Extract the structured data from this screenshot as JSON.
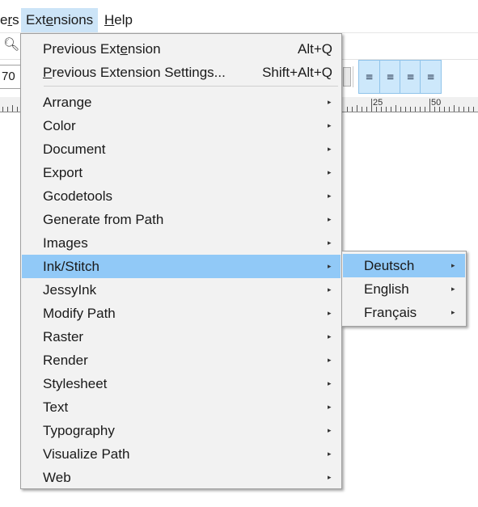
{
  "menubar": {
    "items": [
      {
        "label": "ers",
        "underline_index": 1
      },
      {
        "label": "Extensions",
        "underline_index": 3
      },
      {
        "label": "Help",
        "underline_index": 0
      }
    ]
  },
  "toolbar": {
    "zoom_icon": "zoom-icon",
    "width_value": "70",
    "align_icons": [
      "align-icon",
      "align-icon",
      "align-icon",
      "align-icon"
    ]
  },
  "ruler": {
    "labels": [
      "25",
      "50"
    ]
  },
  "extensions_menu": {
    "items": [
      {
        "label": "Previous Extension",
        "shortcut": "Alt+Q",
        "has_submenu": false
      },
      {
        "label": "Previous Extension Settings...",
        "shortcut": "Shift+Alt+Q",
        "has_submenu": false
      },
      {
        "label": "Arrange",
        "has_submenu": true
      },
      {
        "label": "Color",
        "has_submenu": true
      },
      {
        "label": "Document",
        "has_submenu": true
      },
      {
        "label": "Export",
        "has_submenu": true
      },
      {
        "label": "Gcodetools",
        "has_submenu": true
      },
      {
        "label": "Generate from Path",
        "has_submenu": true
      },
      {
        "label": "Images",
        "has_submenu": true
      },
      {
        "label": "Ink/Stitch",
        "has_submenu": true,
        "highlighted": true
      },
      {
        "label": "JessyInk",
        "has_submenu": true
      },
      {
        "label": "Modify Path",
        "has_submenu": true
      },
      {
        "label": "Raster",
        "has_submenu": true
      },
      {
        "label": "Render",
        "has_submenu": true
      },
      {
        "label": "Stylesheet",
        "has_submenu": true
      },
      {
        "label": "Text",
        "has_submenu": true
      },
      {
        "label": "Typography",
        "has_submenu": true
      },
      {
        "label": "Visualize Path",
        "has_submenu": true
      },
      {
        "label": "Web",
        "has_submenu": true
      }
    ]
  },
  "inkstitch_submenu": {
    "items": [
      {
        "label": "Deutsch",
        "has_submenu": true,
        "highlighted": true
      },
      {
        "label": "English",
        "has_submenu": true
      },
      {
        "label": "Français",
        "has_submenu": true
      }
    ]
  },
  "colors": {
    "highlight": "#91c9f7",
    "menubar_active": "#cce4f7",
    "menu_bg": "#f2f2f2"
  }
}
